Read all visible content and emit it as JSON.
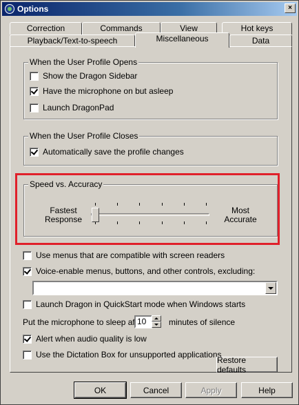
{
  "window": {
    "title": "Options",
    "close_symbol": "×"
  },
  "tabs": {
    "row_back": [
      "Correction",
      "Commands",
      "View",
      "Hot keys"
    ],
    "row_front": [
      "Playback/Text-to-speech",
      "Miscellaneous",
      "Data"
    ],
    "active": "Miscellaneous"
  },
  "open_group": {
    "label": "When the User Profile Opens",
    "items": [
      {
        "label": "Show the Dragon Sidebar",
        "checked": false
      },
      {
        "label": "Have the microphone on but asleep",
        "checked": true
      },
      {
        "label": "Launch DragonPad",
        "checked": false
      }
    ]
  },
  "close_group": {
    "label": "When the User Profile Closes",
    "items": [
      {
        "label": "Automatically save the profile changes",
        "checked": true
      }
    ]
  },
  "speed_group": {
    "label": "Speed vs. Accuracy",
    "left_label_line1": "Fastest",
    "left_label_line2": "Response",
    "right_label_line1": "Most",
    "right_label_line2": "Accurate",
    "slider_position": 0,
    "tick_count": 6
  },
  "options": {
    "screen_readers": {
      "label": "Use menus that are compatible with screen readers",
      "checked": false
    },
    "voice_enable": {
      "label": "Voice-enable menus, buttons, and other controls, excluding:",
      "checked": true
    },
    "exclusion_value": "",
    "quickstart": {
      "label": "Launch Dragon in QuickStart mode when Windows starts",
      "checked": false
    },
    "sleep_prefix": "Put the microphone to sleep after",
    "sleep_value": "10",
    "sleep_suffix": "minutes of silence",
    "alert_audio": {
      "label": "Alert when audio quality is low",
      "checked": true
    },
    "dictation_box": {
      "label": "Use the Dictation Box for unsupported applications",
      "checked": false
    }
  },
  "buttons": {
    "restore": "Restore defaults",
    "ok": "OK",
    "cancel": "Cancel",
    "apply": "Apply",
    "help": "Help"
  },
  "colors": {
    "highlight_box": "#e0202a",
    "title_bar": "#0a246a",
    "face": "#d4d0c8"
  }
}
